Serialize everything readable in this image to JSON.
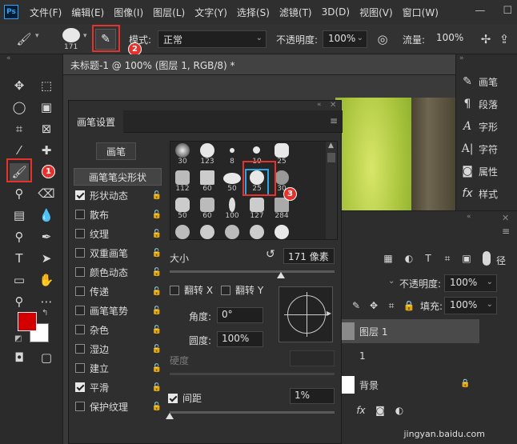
{
  "menubar": {
    "logo": "Ps",
    "items": [
      "文件(F)",
      "编辑(E)",
      "图像(I)",
      "图层(L)",
      "文字(Y)",
      "选择(S)",
      "滤镜(T)",
      "3D(D)",
      "视图(V)",
      "窗口(W)"
    ]
  },
  "options_bar": {
    "brush_size": "171",
    "mode_label": "模式:",
    "mode_value": "正常",
    "opacity_label": "不透明度:",
    "opacity_value": "100%",
    "flow_label": "流量:",
    "flow_value": "100%"
  },
  "document": {
    "tab_title": "未标题-1 @ 100% (图层 1, RGB/8) *"
  },
  "right_panel": {
    "items": [
      "画笔",
      "段落",
      "字形",
      "字符",
      "属性",
      "样式"
    ]
  },
  "brush_panel": {
    "tab": "画笔设置",
    "brushes_button": "画笔",
    "tip_shape_label": "画笔笔尖形状",
    "options": [
      {
        "label": "形状动态",
        "checked": true
      },
      {
        "label": "散布",
        "checked": false
      },
      {
        "label": "纹理",
        "checked": false
      },
      {
        "label": "双重画笔",
        "checked": false
      },
      {
        "label": "颜色动态",
        "checked": false
      },
      {
        "label": "传递",
        "checked": false
      },
      {
        "label": "画笔笔势",
        "checked": false
      },
      {
        "label": "杂色",
        "checked": false
      },
      {
        "label": "湿边",
        "checked": false
      },
      {
        "label": "建立",
        "checked": false
      },
      {
        "label": "平滑",
        "checked": true
      },
      {
        "label": "保护纹理",
        "checked": false
      }
    ],
    "tips": [
      "30",
      "123",
      "8",
      "10",
      "25",
      "112",
      "60",
      "50",
      "25",
      "30",
      "50",
      "60",
      "100",
      "127",
      "284",
      "80",
      "174",
      "175",
      "306",
      "50"
    ],
    "size_label": "大小",
    "size_value": "171 像素",
    "flip_x": "翻转 X",
    "flip_y": "翻转 Y",
    "angle_label": "角度:",
    "angle_value": "0°",
    "roundness_label": "圆度:",
    "roundness_value": "100%",
    "hardness_label": "硬度",
    "spacing_label": "间距",
    "spacing_value": "1%"
  },
  "layers_panel": {
    "opacity_label": "不透明度:",
    "opacity_value": "100%",
    "fill_label": "填充:",
    "fill_value": "100%",
    "layer_name": "图层 1",
    "layer_index": "1",
    "background_name": "背景"
  },
  "badges": [
    "1",
    "2",
    "3"
  ],
  "watermark": "jingyan.baidu.com",
  "colors": {
    "foreground": "#d40000",
    "background": "#ffffff",
    "highlight": "#e5322d",
    "selected_tip": "#2aa7e8"
  }
}
